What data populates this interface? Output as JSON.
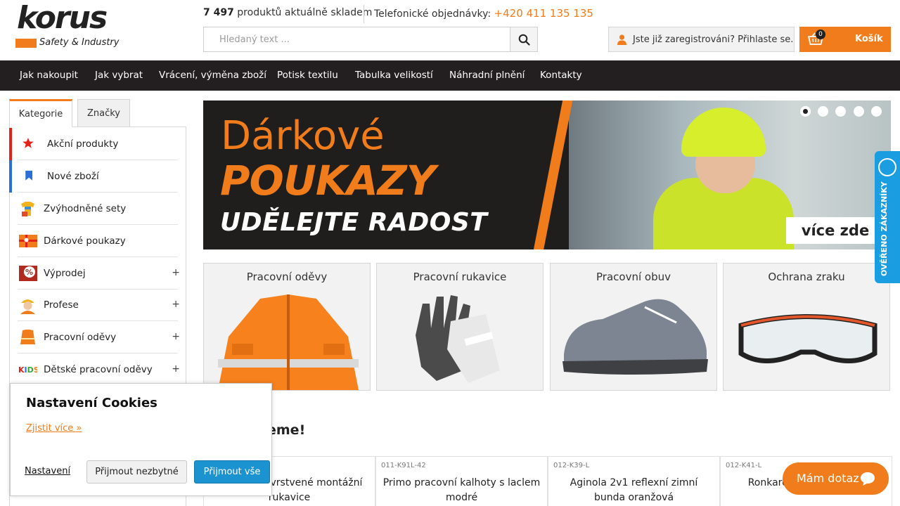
{
  "logo": {
    "word": "korus",
    "sub": "Safety & Industry"
  },
  "header": {
    "stock_count": "7 497",
    "stock_text": "produktů aktuálně skladem",
    "phone_label": "Telefonické objednávky:",
    "phone_number": "+420 411 135 135",
    "search_placeholder": "Hledaný text ...",
    "login_text": "Jste již zaregistrováni? Přihlaste se.",
    "cart_label": "Košík",
    "cart_count": "0"
  },
  "nav": [
    "Jak nakoupit",
    "Jak vybrat",
    "Vrácení, výměna zboží",
    "Potisk textilu",
    "Tabulka velikostí",
    "Náhradní plnění",
    "Kontakty"
  ],
  "sidebar": {
    "tabs": [
      "Kategorie",
      "Značky"
    ],
    "categories": [
      {
        "label": "Akční produkty",
        "icon": "star-icon",
        "expandable": false,
        "accent": "#e32119"
      },
      {
        "label": "Nové zboží",
        "icon": "bookmark-icon",
        "expandable": false,
        "accent": "#2a6fd6"
      },
      {
        "label": "Zvýhodněné sety",
        "icon": "tshirt-set-icon",
        "expandable": false
      },
      {
        "label": "Dárkové poukazy",
        "icon": "gift-voucher-icon",
        "expandable": false
      },
      {
        "label": "Výprodej",
        "icon": "sale-percent-icon",
        "expandable": true
      },
      {
        "label": "Profese",
        "icon": "worker-icon",
        "expandable": true
      },
      {
        "label": "Pracovní oděvy",
        "icon": "workwear-icon",
        "expandable": true
      },
      {
        "label": "Dětské pracovní oděvy",
        "icon": "kids-icon",
        "expandable": true
      }
    ],
    "plus": "+"
  },
  "banner": {
    "line1": "Dárkové",
    "line2": "POUKAZY",
    "line3": "UDĚLEJTE RADOST",
    "cta": "více zde",
    "slides": 5,
    "active_slide": 1
  },
  "tiles": [
    {
      "label": "Pracovní oděvy",
      "icon": "orange-jacket-image"
    },
    {
      "label": "Pracovní rukavice",
      "icon": "gloves-image"
    },
    {
      "label": "Pracovní obuv",
      "icon": "shoe-image"
    },
    {
      "label": "Ochrana zraku",
      "icon": "safety-glasses-image"
    }
  ],
  "section_title": "eme!",
  "products": [
    {
      "code": "",
      "name": "ack jemné vrstvené montážní rukavice"
    },
    {
      "code": "011-K91L-42",
      "name": "Primo pracovní kalhoty s laclem modré"
    },
    {
      "code": "012-K39-L",
      "name": "Aginola 2v1 reflexní zimní bunda oranžová"
    },
    {
      "code": "012-K41-L",
      "name": "Ronkaro r bunda modrá"
    }
  ],
  "verified": "OVĚŘENO ZÁKAZNÍKY",
  "chat": "Mám dotaz",
  "cookies": {
    "title": "Nastavení Cookies",
    "more": "Zjistit více »",
    "settings": "Nastavení",
    "necessary": "Přijmout nezbytné",
    "accept_all": "Přijmout vše"
  },
  "colors": {
    "accent": "#f07c1b",
    "nav_bg": "#231f20",
    "blue": "#1b93d1"
  }
}
